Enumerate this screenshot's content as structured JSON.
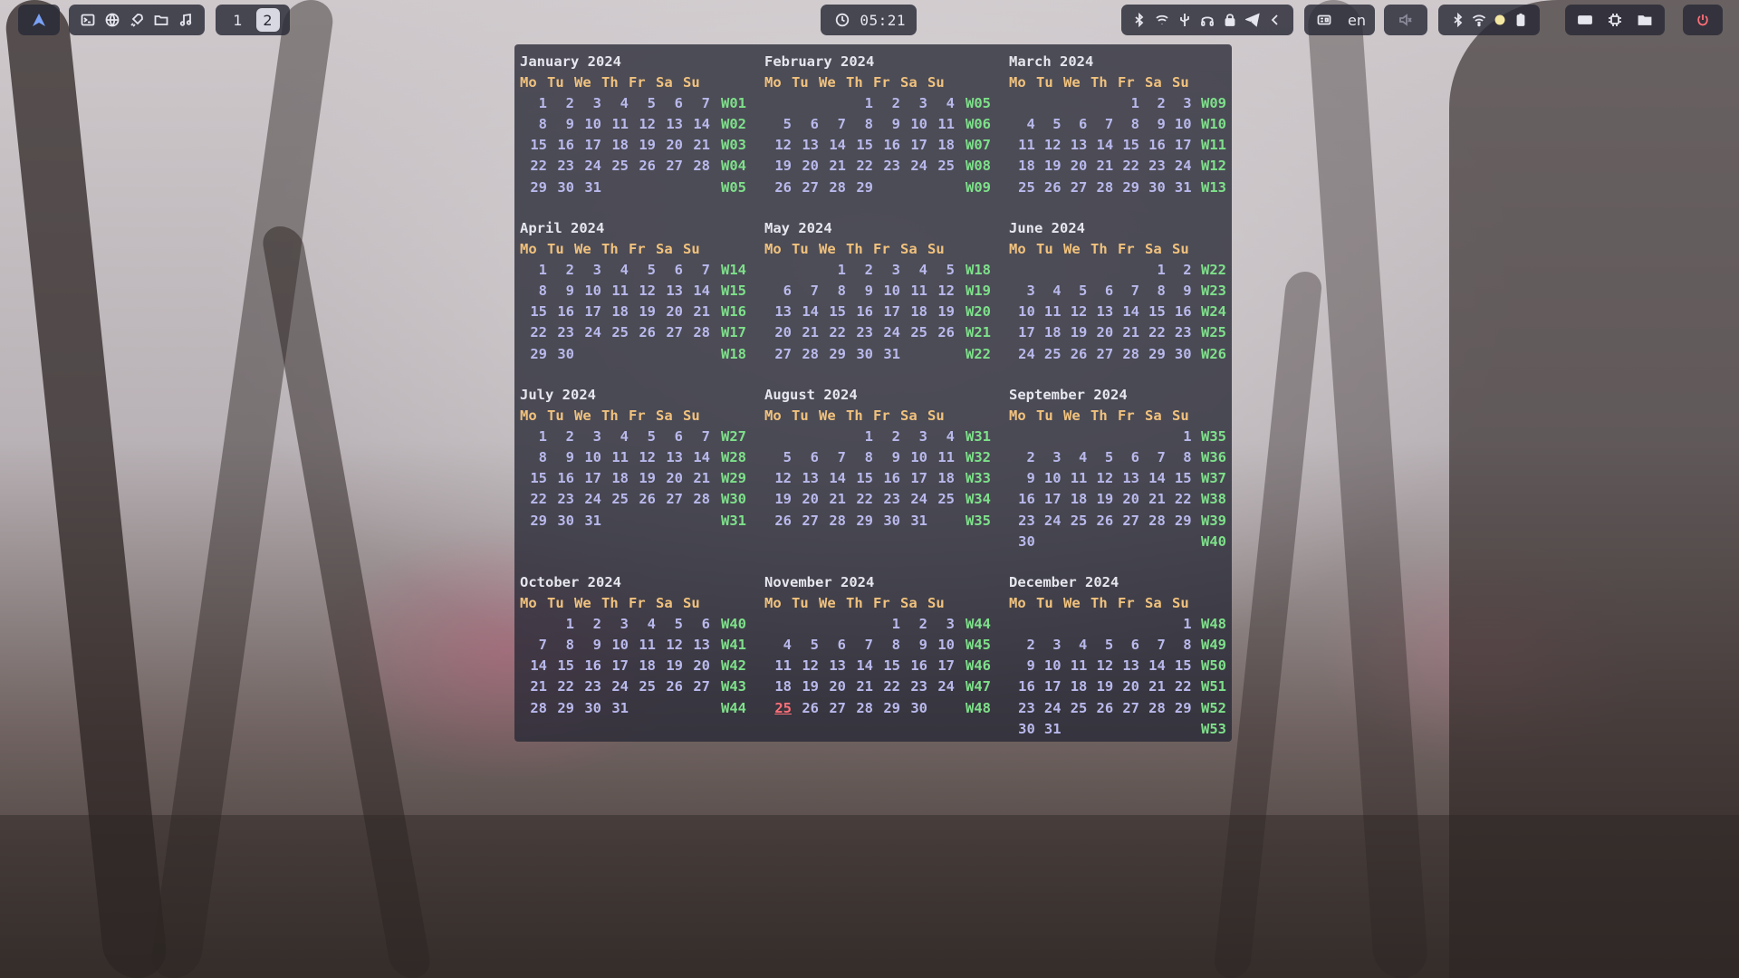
{
  "topbar": {
    "logo_icon": "arch-logo-icon",
    "apps": [
      {
        "name": "terminal-icon"
      },
      {
        "name": "browser-icon"
      },
      {
        "name": "rocket-icon"
      },
      {
        "name": "file-manager-icon"
      },
      {
        "name": "music-icon"
      }
    ],
    "workspaces": [
      "1",
      "2"
    ],
    "active_workspace": "2",
    "clock": "05:21",
    "tray_icons": [
      "bluetooth-icon",
      "network-icon",
      "usb-icon",
      "headphones-icon",
      "lock-icon",
      "telegram-icon",
      "chevron-left-icon"
    ],
    "keyboard_layout": "en",
    "volume_icon": "volume-muted-icon",
    "status_icons": [
      "bluetooth-icon",
      "wifi-icon",
      "brightness-icon",
      "battery-icon"
    ],
    "utility_icons": [
      "keyboard-icon",
      "chip-icon",
      "folder-icon"
    ],
    "power_icon": "power-icon"
  },
  "calendar": {
    "weekday_headers": [
      "Mo",
      "Tu",
      "We",
      "Th",
      "Fr",
      "Sa",
      "Su"
    ],
    "today": {
      "month": 10,
      "day": 25
    },
    "months": [
      {
        "title": "January 2024",
        "weeks": [
          [
            "1",
            "2",
            "3",
            "4",
            "5",
            "6",
            "7",
            "W01"
          ],
          [
            "8",
            "9",
            "10",
            "11",
            "12",
            "13",
            "14",
            "W02"
          ],
          [
            "15",
            "16",
            "17",
            "18",
            "19",
            "20",
            "21",
            "W03"
          ],
          [
            "22",
            "23",
            "24",
            "25",
            "26",
            "27",
            "28",
            "W04"
          ],
          [
            "29",
            "30",
            "31",
            "",
            "",
            "",
            "",
            "W05"
          ]
        ]
      },
      {
        "title": "February 2024",
        "weeks": [
          [
            "",
            "",
            "",
            "1",
            "2",
            "3",
            "4",
            "W05"
          ],
          [
            "5",
            "6",
            "7",
            "8",
            "9",
            "10",
            "11",
            "W06"
          ],
          [
            "12",
            "13",
            "14",
            "15",
            "16",
            "17",
            "18",
            "W07"
          ],
          [
            "19",
            "20",
            "21",
            "22",
            "23",
            "24",
            "25",
            "W08"
          ],
          [
            "26",
            "27",
            "28",
            "29",
            "",
            "",
            "",
            "W09"
          ]
        ]
      },
      {
        "title": "March 2024",
        "weeks": [
          [
            "",
            "",
            "",
            "",
            "1",
            "2",
            "3",
            "W09"
          ],
          [
            "4",
            "5",
            "6",
            "7",
            "8",
            "9",
            "10",
            "W10"
          ],
          [
            "11",
            "12",
            "13",
            "14",
            "15",
            "16",
            "17",
            "W11"
          ],
          [
            "18",
            "19",
            "20",
            "21",
            "22",
            "23",
            "24",
            "W12"
          ],
          [
            "25",
            "26",
            "27",
            "28",
            "29",
            "30",
            "31",
            "W13"
          ]
        ]
      },
      {
        "title": "April 2024",
        "weeks": [
          [
            "1",
            "2",
            "3",
            "4",
            "5",
            "6",
            "7",
            "W14"
          ],
          [
            "8",
            "9",
            "10",
            "11",
            "12",
            "13",
            "14",
            "W15"
          ],
          [
            "15",
            "16",
            "17",
            "18",
            "19",
            "20",
            "21",
            "W16"
          ],
          [
            "22",
            "23",
            "24",
            "25",
            "26",
            "27",
            "28",
            "W17"
          ],
          [
            "29",
            "30",
            "",
            "",
            "",
            "",
            "",
            "W18"
          ]
        ]
      },
      {
        "title": "May 2024",
        "weeks": [
          [
            "",
            "",
            "1",
            "2",
            "3",
            "4",
            "5",
            "W18"
          ],
          [
            "6",
            "7",
            "8",
            "9",
            "10",
            "11",
            "12",
            "W19"
          ],
          [
            "13",
            "14",
            "15",
            "16",
            "17",
            "18",
            "19",
            "W20"
          ],
          [
            "20",
            "21",
            "22",
            "23",
            "24",
            "25",
            "26",
            "W21"
          ],
          [
            "27",
            "28",
            "29",
            "30",
            "31",
            "",
            "",
            "W22"
          ]
        ]
      },
      {
        "title": "June 2024",
        "weeks": [
          [
            "",
            "",
            "",
            "",
            "",
            "1",
            "2",
            "W22"
          ],
          [
            "3",
            "4",
            "5",
            "6",
            "7",
            "8",
            "9",
            "W23"
          ],
          [
            "10",
            "11",
            "12",
            "13",
            "14",
            "15",
            "16",
            "W24"
          ],
          [
            "17",
            "18",
            "19",
            "20",
            "21",
            "22",
            "23",
            "W25"
          ],
          [
            "24",
            "25",
            "26",
            "27",
            "28",
            "29",
            "30",
            "W26"
          ]
        ]
      },
      {
        "title": "July 2024",
        "weeks": [
          [
            "1",
            "2",
            "3",
            "4",
            "5",
            "6",
            "7",
            "W27"
          ],
          [
            "8",
            "9",
            "10",
            "11",
            "12",
            "13",
            "14",
            "W28"
          ],
          [
            "15",
            "16",
            "17",
            "18",
            "19",
            "20",
            "21",
            "W29"
          ],
          [
            "22",
            "23",
            "24",
            "25",
            "26",
            "27",
            "28",
            "W30"
          ],
          [
            "29",
            "30",
            "31",
            "",
            "",
            "",
            "",
            "W31"
          ]
        ]
      },
      {
        "title": "August 2024",
        "weeks": [
          [
            "",
            "",
            "",
            "1",
            "2",
            "3",
            "4",
            "W31"
          ],
          [
            "5",
            "6",
            "7",
            "8",
            "9",
            "10",
            "11",
            "W32"
          ],
          [
            "12",
            "13",
            "14",
            "15",
            "16",
            "17",
            "18",
            "W33"
          ],
          [
            "19",
            "20",
            "21",
            "22",
            "23",
            "24",
            "25",
            "W34"
          ],
          [
            "26",
            "27",
            "28",
            "29",
            "30",
            "31",
            "",
            "W35"
          ]
        ]
      },
      {
        "title": "September 2024",
        "weeks": [
          [
            "",
            "",
            "",
            "",
            "",
            "",
            "1",
            "W35"
          ],
          [
            "2",
            "3",
            "4",
            "5",
            "6",
            "7",
            "8",
            "W36"
          ],
          [
            "9",
            "10",
            "11",
            "12",
            "13",
            "14",
            "15",
            "W37"
          ],
          [
            "16",
            "17",
            "18",
            "19",
            "20",
            "21",
            "22",
            "W38"
          ],
          [
            "23",
            "24",
            "25",
            "26",
            "27",
            "28",
            "29",
            "W39"
          ],
          [
            "30",
            "",
            "",
            "",
            "",
            "",
            "",
            "W40"
          ]
        ]
      },
      {
        "title": "October 2024",
        "weeks": [
          [
            "",
            "1",
            "2",
            "3",
            "4",
            "5",
            "6",
            "W40"
          ],
          [
            "7",
            "8",
            "9",
            "10",
            "11",
            "12",
            "13",
            "W41"
          ],
          [
            "14",
            "15",
            "16",
            "17",
            "18",
            "19",
            "20",
            "W42"
          ],
          [
            "21",
            "22",
            "23",
            "24",
            "25",
            "26",
            "27",
            "W43"
          ],
          [
            "28",
            "29",
            "30",
            "31",
            "",
            "",
            "",
            "W44"
          ]
        ]
      },
      {
        "title": "November 2024",
        "weeks": [
          [
            "",
            "",
            "",
            "",
            "1",
            "2",
            "3",
            "W44"
          ],
          [
            "4",
            "5",
            "6",
            "7",
            "8",
            "9",
            "10",
            "W45"
          ],
          [
            "11",
            "12",
            "13",
            "14",
            "15",
            "16",
            "17",
            "W46"
          ],
          [
            "18",
            "19",
            "20",
            "21",
            "22",
            "23",
            "24",
            "W47"
          ],
          [
            "25",
            "26",
            "27",
            "28",
            "29",
            "30",
            "",
            "W48"
          ]
        ]
      },
      {
        "title": "December 2024",
        "weeks": [
          [
            "",
            "",
            "",
            "",
            "",
            "",
            "1",
            "W48"
          ],
          [
            "2",
            "3",
            "4",
            "5",
            "6",
            "7",
            "8",
            "W49"
          ],
          [
            "9",
            "10",
            "11",
            "12",
            "13",
            "14",
            "15",
            "W50"
          ],
          [
            "16",
            "17",
            "18",
            "19",
            "20",
            "21",
            "22",
            "W51"
          ],
          [
            "23",
            "24",
            "25",
            "26",
            "27",
            "28",
            "29",
            "W52"
          ],
          [
            "30",
            "31",
            "",
            "",
            "",
            "",
            "",
            "W53"
          ]
        ]
      }
    ]
  },
  "colors": {
    "weekday": "#f1c27d",
    "day": "#b9b9ec",
    "week_number": "#7ee08a",
    "today": "#ff6f78",
    "panel_bg": "#282a36"
  }
}
